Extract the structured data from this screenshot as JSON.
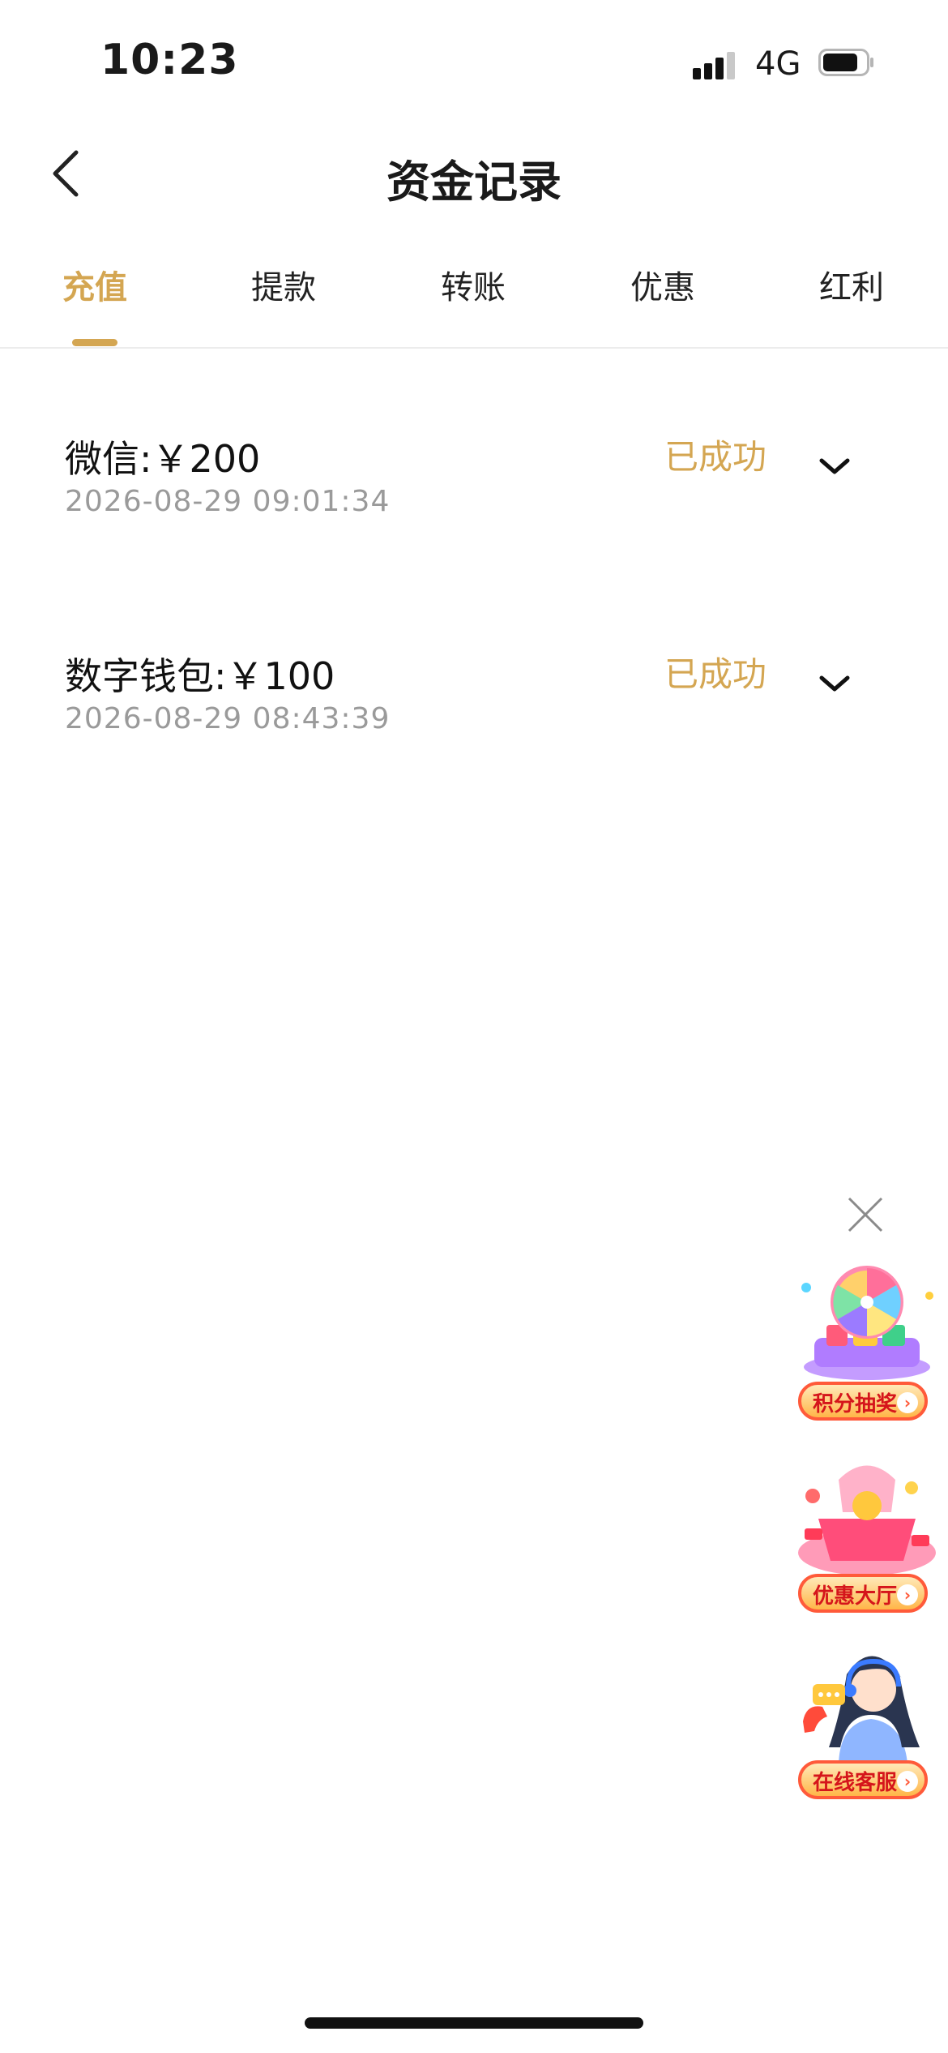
{
  "status_bar": {
    "time": "10:23",
    "network": "4G",
    "signal_icon": "signal-bars-icon",
    "battery_icon": "battery-icon"
  },
  "header": {
    "title": "资金记录",
    "back_icon": "chevron-left-icon"
  },
  "tabs": [
    {
      "label": "充值",
      "active": true
    },
    {
      "label": "提款",
      "active": false
    },
    {
      "label": "转账",
      "active": false
    },
    {
      "label": "优惠",
      "active": false
    },
    {
      "label": "红利",
      "active": false
    }
  ],
  "records": [
    {
      "title": "微信:￥200",
      "time": "2026-08-29 09:01:34",
      "status": "已成功",
      "expand_icon": "chevron-down-icon"
    },
    {
      "title": "数字钱包:￥100",
      "time": "2026-08-29 08:43:39",
      "status": "已成功",
      "expand_icon": "chevron-down-icon"
    }
  ],
  "floating_widgets": {
    "close_icon": "close-icon",
    "items": [
      {
        "label": "积分抽奖",
        "icon": "prize-wheel-icon"
      },
      {
        "label": "优惠大厅",
        "icon": "gift-box-icon"
      },
      {
        "label": "在线客服",
        "icon": "customer-service-icon"
      }
    ]
  },
  "colors": {
    "accent": "#d4a652",
    "text": "#111111",
    "muted": "#9a9a9a",
    "divider": "#ececec",
    "promo_red": "#d5151b"
  }
}
